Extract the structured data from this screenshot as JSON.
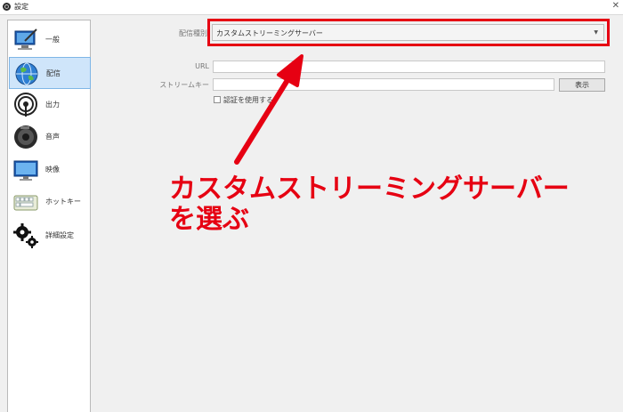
{
  "window": {
    "title": "設定",
    "close_glyph": "✕"
  },
  "sidebar": {
    "items": [
      {
        "label": "一般",
        "icon": "monitor-pen-icon",
        "selected": false
      },
      {
        "label": "配信",
        "icon": "globe-icon",
        "selected": true
      },
      {
        "label": "出力",
        "icon": "broadcast-antenna-icon",
        "selected": false
      },
      {
        "label": "音声",
        "icon": "speaker-icon",
        "selected": false
      },
      {
        "label": "映像",
        "icon": "display-monitor-icon",
        "selected": false
      },
      {
        "label": "ホットキー",
        "icon": "keyboard-icon",
        "selected": false
      },
      {
        "label": "詳細設定",
        "icon": "gears-icon",
        "selected": false
      }
    ]
  },
  "stream": {
    "service_type_label": "配信種別",
    "service_type_value": "カスタムストリーミングサーバー",
    "url_label": "URL",
    "url_value": "",
    "stream_key_label": "ストリームキー",
    "stream_key_value": "",
    "show_button_label": "表示",
    "use_auth_label": "認証を使用する",
    "use_auth_checked": false
  },
  "annotation": {
    "line1": "カスタムストリーミングサーバー",
    "line2": "を選ぶ",
    "color": "#e60012"
  }
}
